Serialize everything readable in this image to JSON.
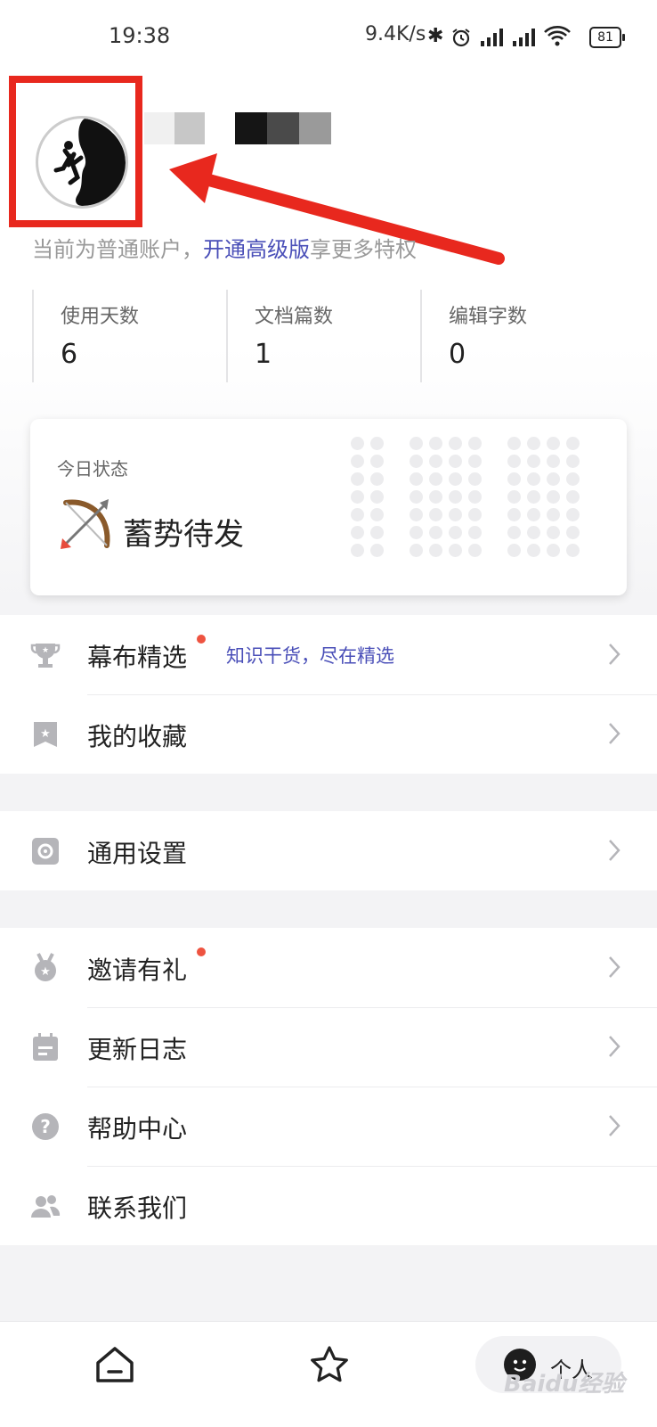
{
  "status_bar": {
    "time": "19:38",
    "net_speed": "9.4K/s",
    "battery": "81"
  },
  "profile": {
    "account_prefix": "当前为普通账户，",
    "upgrade_link": "开通高级版",
    "account_suffix": "享更多特权"
  },
  "stats": [
    {
      "label": "使用天数",
      "value": "6"
    },
    {
      "label": "文档篇数",
      "value": "1"
    },
    {
      "label": "编辑字数",
      "value": "0"
    }
  ],
  "status_card": {
    "label": "今日状态",
    "value": "蓄势待发"
  },
  "menu": {
    "featured": {
      "label": "幕布精选",
      "subtitle": "知识干货，尽在精选"
    },
    "favorites": {
      "label": "我的收藏"
    },
    "settings": {
      "label": "通用设置"
    },
    "invite": {
      "label": "邀请有礼"
    },
    "changelog": {
      "label": "更新日志"
    },
    "help": {
      "label": "帮助中心"
    },
    "contact": {
      "label": "联系我们"
    }
  },
  "tabbar": {
    "me_label": "个人"
  },
  "watermark": "Baidu经验",
  "colors": {
    "accent": "#4a4fb8",
    "highlight_red": "#e8281e",
    "badge_dot": "#ee5340"
  }
}
